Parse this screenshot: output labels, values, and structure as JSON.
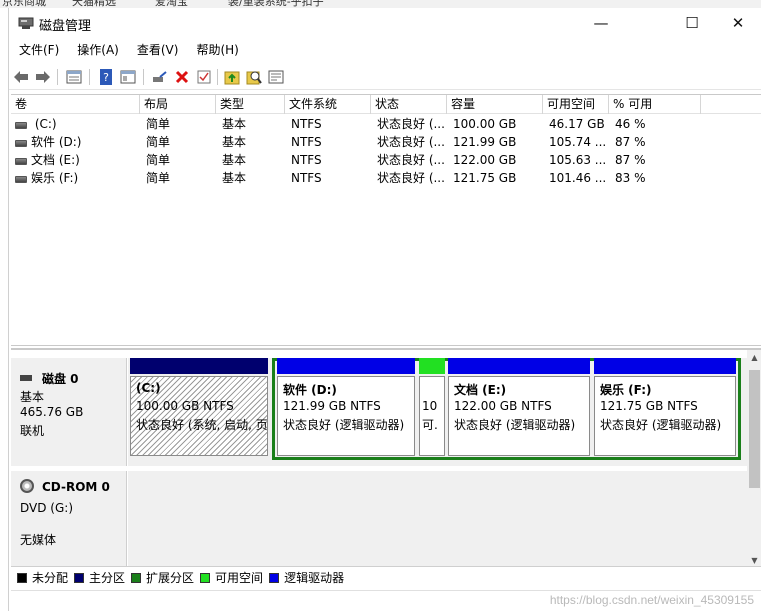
{
  "window": {
    "title": "磁盘管理",
    "controls": {
      "minimize": "—",
      "maximize": "☐",
      "close": "✕"
    }
  },
  "menu": [
    "文件(F)",
    "操作(A)",
    "查看(V)",
    "帮助(H)"
  ],
  "toolbar_icons": [
    "back-icon",
    "forward-icon",
    "list-view-icon",
    "help-icon",
    "properties-icon",
    "connect-icon",
    "delete-icon",
    "check-icon",
    "folder-up-icon",
    "search-icon",
    "settings-icon"
  ],
  "columns": [
    "卷",
    "布局",
    "类型",
    "文件系统",
    "状态",
    "容量",
    "可用空间",
    "% 可用"
  ],
  "volumes": [
    {
      "name": " (C:)",
      "layout": "简单",
      "type": "基本",
      "fs": "NTFS",
      "status": "状态良好 (...",
      "capacity": "100.00 GB",
      "free": "46.17 GB",
      "pct": "46 %"
    },
    {
      "name": "软件 (D:)",
      "layout": "简单",
      "type": "基本",
      "fs": "NTFS",
      "status": "状态良好 (...",
      "capacity": "121.99 GB",
      "free": "105.74 ...",
      "pct": "87 %"
    },
    {
      "name": "文档 (E:)",
      "layout": "简单",
      "type": "基本",
      "fs": "NTFS",
      "status": "状态良好 (...",
      "capacity": "122.00 GB",
      "free": "105.63 ...",
      "pct": "87 %"
    },
    {
      "name": "娱乐 (F:)",
      "layout": "简单",
      "type": "基本",
      "fs": "NTFS",
      "status": "状态良好 (...",
      "capacity": "121.75 GB",
      "free": "101.46 ...",
      "pct": "83 %"
    }
  ],
  "disk0": {
    "name": "磁盘 0",
    "type": "基本",
    "size": "465.76 GB",
    "state": "联机",
    "partitions": [
      {
        "label": "(C:)",
        "size": "100.00 GB NTFS",
        "status": "状态良好 (系统, 启动, 页"
      },
      {
        "label": "软件  (D:)",
        "size": "121.99 GB NTFS",
        "status": "状态良好 (逻辑驱动器)"
      },
      {
        "label": "",
        "size": "10",
        "status": "可."
      },
      {
        "label": "文档  (E:)",
        "size": "122.00 GB NTFS",
        "status": "状态良好 (逻辑驱动器)"
      },
      {
        "label": "娱乐  (F:)",
        "size": "121.75 GB NTFS",
        "status": "状态良好 (逻辑驱动器)"
      }
    ]
  },
  "cdrom0": {
    "name": "CD-ROM 0",
    "type": "DVD (G:)",
    "media": "无媒体"
  },
  "legend": [
    {
      "label": "未分配",
      "color": "#000000"
    },
    {
      "label": "主分区",
      "color": "#00006e"
    },
    {
      "label": "扩展分区",
      "color": "#1a7f1a"
    },
    {
      "label": "可用空间",
      "color": "#22e022"
    },
    {
      "label": "逻辑驱动器",
      "color": "#0000e6"
    }
  ],
  "colors": {
    "primary_bar": "#00006e",
    "logical_bar": "#0000e6",
    "free_bar": "#22e022",
    "extended_border": "#1a7f1a"
  },
  "top_strip": [
    "京东商城",
    "天猫精选",
    "爱淘宝",
    "装/重装系统-乎扣子"
  ],
  "watermark": "https://blog.csdn.net/weixin_45309155"
}
